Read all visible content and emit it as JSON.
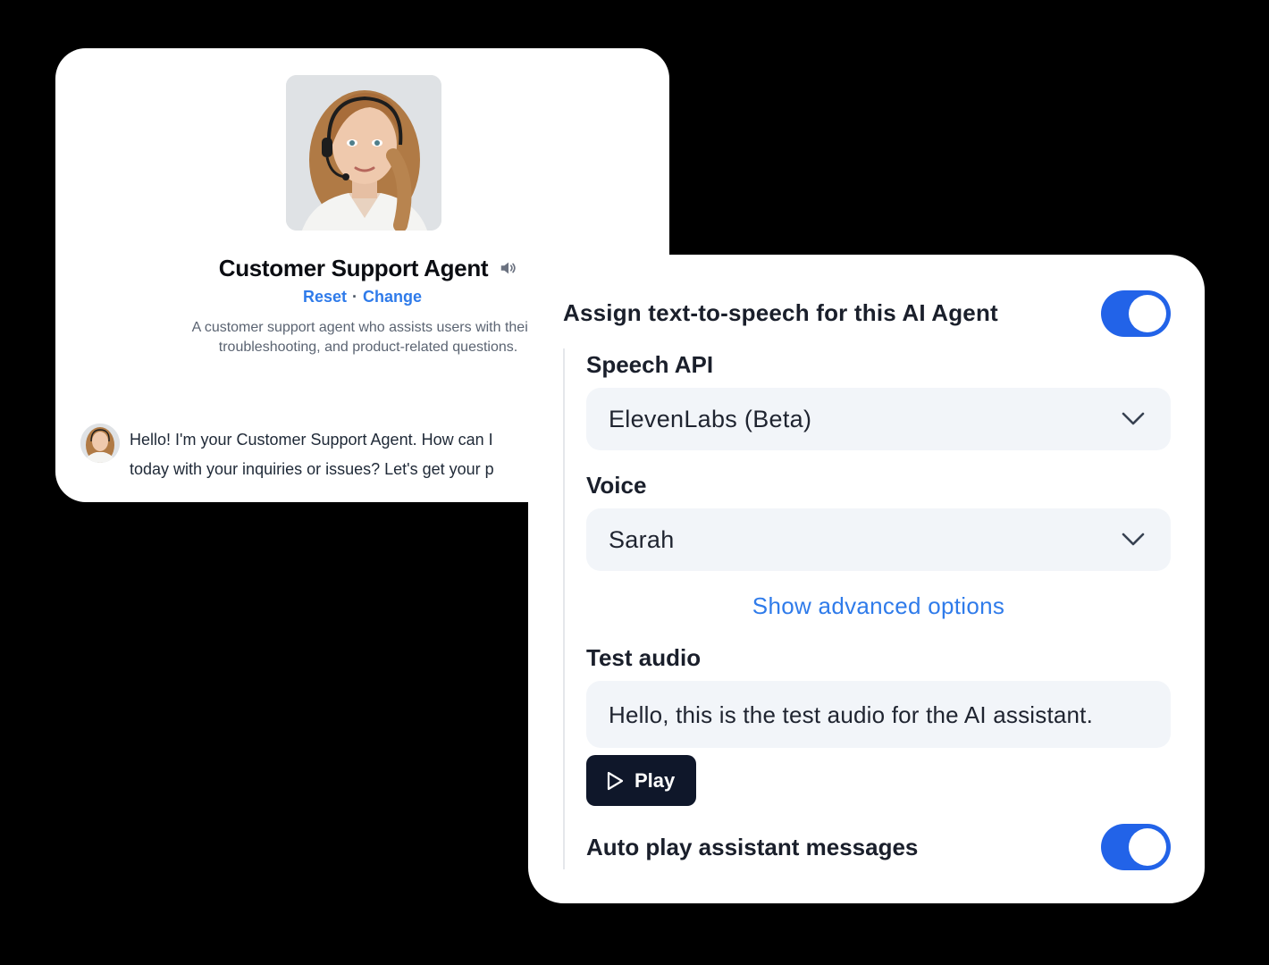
{
  "agent_card": {
    "name": "Customer Support Agent",
    "reset_label": "Reset",
    "separator": "·",
    "change_label": "Change",
    "description_line1": "A customer support agent who assists users with their ir",
    "description_line2": "troubleshooting, and product-related questions.",
    "chat_line1": "Hello! I'm your Customer Support Agent. How can I",
    "chat_line2": "today with your inquiries or issues? Let's get your p"
  },
  "tts_panel": {
    "assign_label": "Assign text-to-speech for this AI Agent",
    "assign_enabled": true,
    "speech_api_label": "Speech API",
    "speech_api_value": "ElevenLabs (Beta)",
    "voice_label": "Voice",
    "voice_value": "Sarah",
    "advanced_link": "Show advanced options",
    "test_audio_label": "Test audio",
    "test_audio_value": "Hello, this is the test audio for the AI assistant.",
    "play_label": "Play",
    "autoplay_label": "Auto play assistant messages",
    "autoplay_enabled": true
  },
  "icons": {
    "speaker": "speaker-icon",
    "chevron": "chevron-down-icon",
    "play": "play-icon"
  },
  "colors": {
    "accent_blue": "#2263e8",
    "link_blue": "#2f7bea",
    "dark_button": "#0f172a",
    "field_bg": "#f2f5f9"
  }
}
